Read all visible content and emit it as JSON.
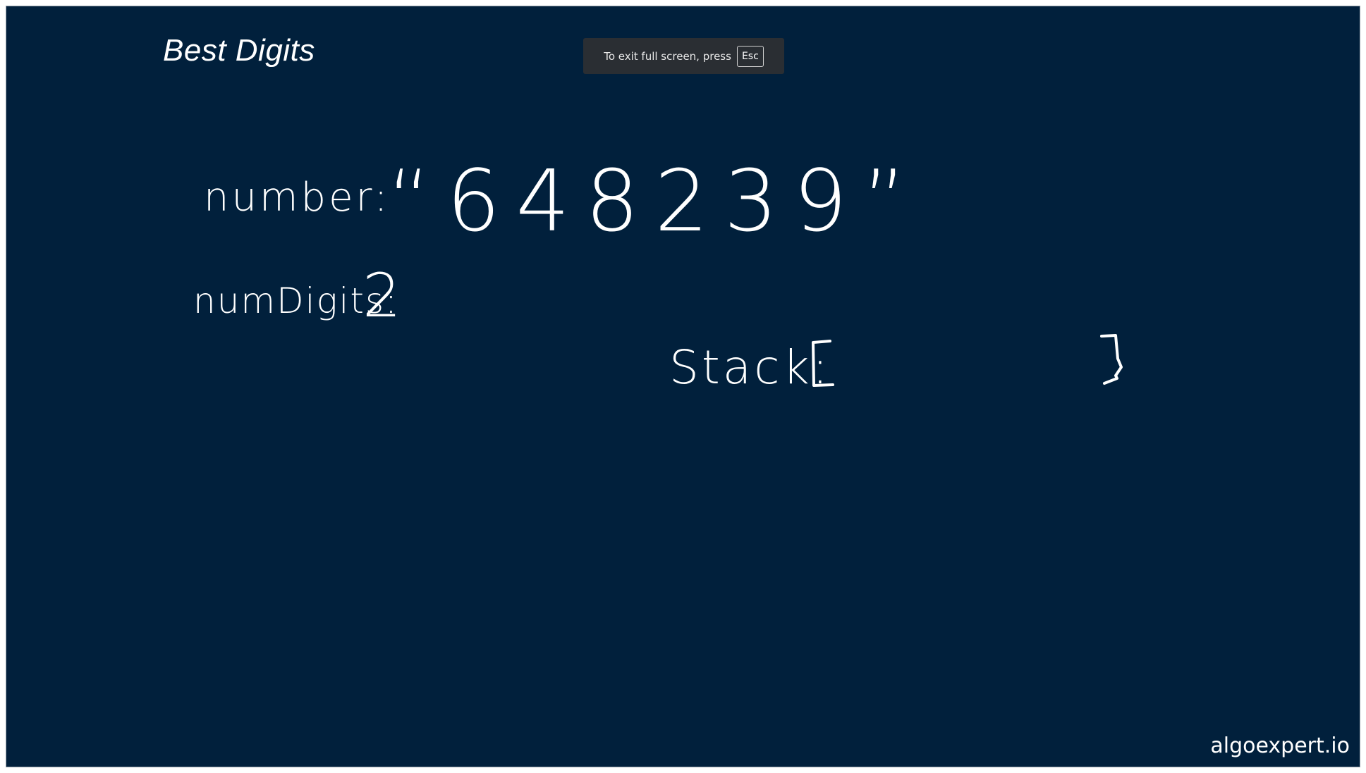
{
  "header": {
    "title": "Best Digits"
  },
  "fullscreen_notice": {
    "text": "To exit full screen, press",
    "key": "Esc"
  },
  "whiteboard": {
    "number_label": "number:",
    "number_value": "“648239”",
    "numdigits_label": "numDigits:",
    "numdigits_value": "2",
    "stack_label": "Stack:",
    "stack_open": "[",
    "stack_close": "]"
  },
  "footer": {
    "brand": "algoexpert.io"
  },
  "colors": {
    "background": "#01203c",
    "ink": "#ffffff",
    "notice_bg": "#2a2e33"
  }
}
